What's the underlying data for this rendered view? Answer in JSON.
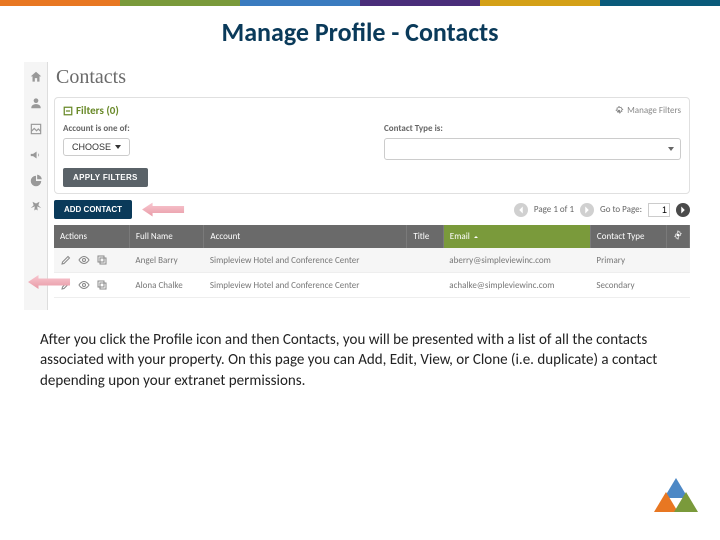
{
  "title": "Manage Profile - Contacts",
  "page_heading": "Contacts",
  "sidebar": {
    "items": [
      {
        "name": "home"
      },
      {
        "name": "profile"
      },
      {
        "name": "media"
      },
      {
        "name": "announce"
      },
      {
        "name": "reports"
      },
      {
        "name": "settings"
      }
    ]
  },
  "filters": {
    "label": "Filters (0)",
    "manage_label": "Manage Filters",
    "account_label": "Account is one of:",
    "account_choose": "CHOOSE",
    "type_label": "Contact Type is:",
    "apply_label": "APPLY FILTERS"
  },
  "toolbar": {
    "add_contact": "ADD CONTACT",
    "page_text": "Page 1 of 1",
    "goto_text": "Go to Page:",
    "goto_value": "1"
  },
  "table": {
    "headers": {
      "actions": "Actions",
      "full_name": "Full Name",
      "account": "Account",
      "title": "Title",
      "email": "Email",
      "contact_type": "Contact Type"
    },
    "rows": [
      {
        "full_name": "Angel Barry",
        "account": "Simpleview Hotel and Conference Center",
        "title": "",
        "email": "aberry@simpleviewinc.com",
        "contact_type": "Primary"
      },
      {
        "full_name": "Alona Chalke",
        "account": "Simpleview Hotel and Conference Center",
        "title": "",
        "email": "achalke@simpleviewinc.com",
        "contact_type": "Secondary"
      }
    ]
  },
  "instruction": "After you click the Profile icon and then Contacts, you will be presented with a list of all the contacts associated with your property. On this page you can Add, Edit, View, or Clone (i.e. duplicate) a contact depending upon your extranet permissions."
}
